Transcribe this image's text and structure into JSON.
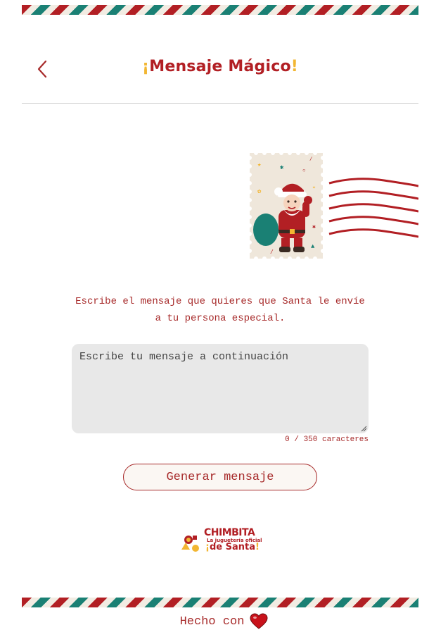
{
  "header": {
    "title_open": "¡",
    "title_text": "Mensaje Mágico",
    "title_close": "!"
  },
  "intro": {
    "line1": "Escribe el mensaje que quieres que Santa le envíe",
    "line2": "a tu persona especial."
  },
  "message": {
    "placeholder": "Escribe tu mensaje a continuación",
    "value": ""
  },
  "counter": {
    "text": "0 / 350 caracteres"
  },
  "generate_button": {
    "label": "Generar mensaje"
  },
  "logo": {
    "word": "CHIMBITA",
    "tagline": "La juguetería oficial",
    "name_open": "¡",
    "name": "de Santa",
    "name_close": "!"
  },
  "footer": {
    "text": "Hecho con"
  },
  "colors": {
    "brand_red": "#b21f24",
    "accent_yellow": "#f2b632",
    "teal": "#1a8074",
    "cream": "#f2ece3"
  },
  "icons": {
    "back": "chevron-left-icon",
    "stamp": "santa-stamp-icon",
    "postmark": "postmark-lines-icon",
    "heart": "heart-icon"
  }
}
